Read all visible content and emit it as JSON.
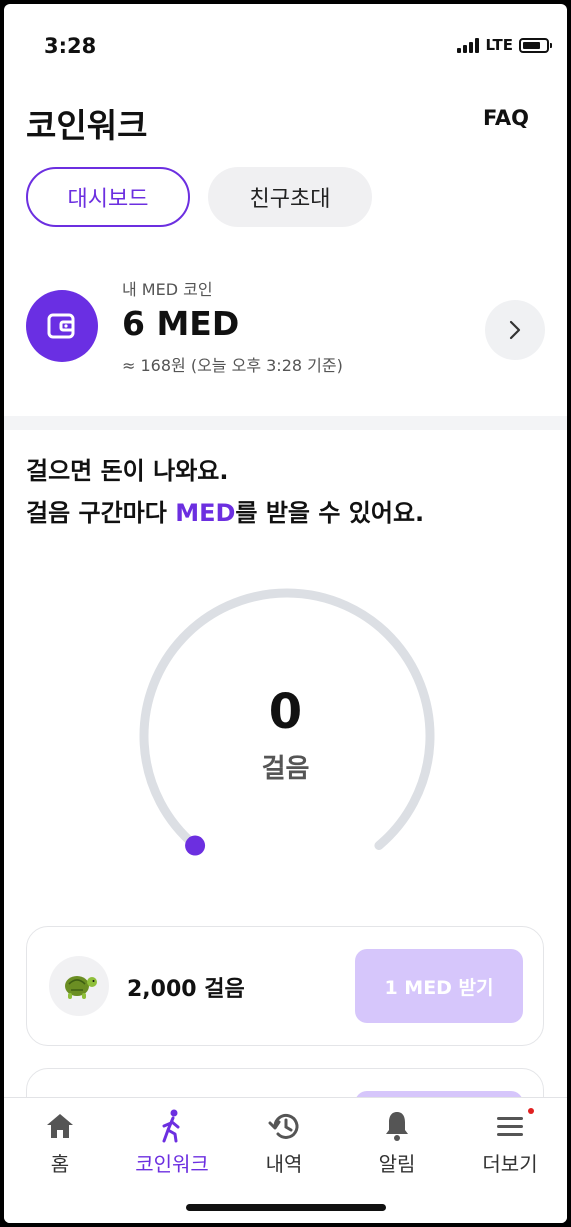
{
  "status": {
    "time": "3:28",
    "network": "LTE"
  },
  "header": {
    "title": "코인워크",
    "faq_label": "FAQ"
  },
  "tabs": [
    {
      "label": "대시보드",
      "active": true
    },
    {
      "label": "친구초대",
      "active": false
    }
  ],
  "balance": {
    "label": "내 MED 코인",
    "amount": "6 MED",
    "sub": "≈ 168원 (오늘 오후 3:28 기준)",
    "icon": "wallet-icon"
  },
  "headline": {
    "line1": "걸으면 돈이 나와요.",
    "line2_prefix": "걸음 구간마다 ",
    "line2_accent": "MED",
    "line2_suffix": "를 받을 수 있어요."
  },
  "gauge": {
    "count": "0",
    "unit": "걸음",
    "progress": 0
  },
  "rewards": [
    {
      "icon": "turtle-icon",
      "steps": "2,000 걸음",
      "button": "1 MED 받기",
      "enabled": false
    }
  ],
  "nav": [
    {
      "label": "홈",
      "icon": "home-icon"
    },
    {
      "label": "코인워크",
      "icon": "walking-icon",
      "active": true
    },
    {
      "label": "내역",
      "icon": "history-icon"
    },
    {
      "label": "알림",
      "icon": "bell-icon"
    },
    {
      "label": "더보기",
      "icon": "menu-icon"
    }
  ],
  "colors": {
    "accent": "#6c2fe0",
    "wallet_bg": "#6a2fe3",
    "button_disabled": "#d6c6fb",
    "gauge_track": "#dcdfe4"
  }
}
